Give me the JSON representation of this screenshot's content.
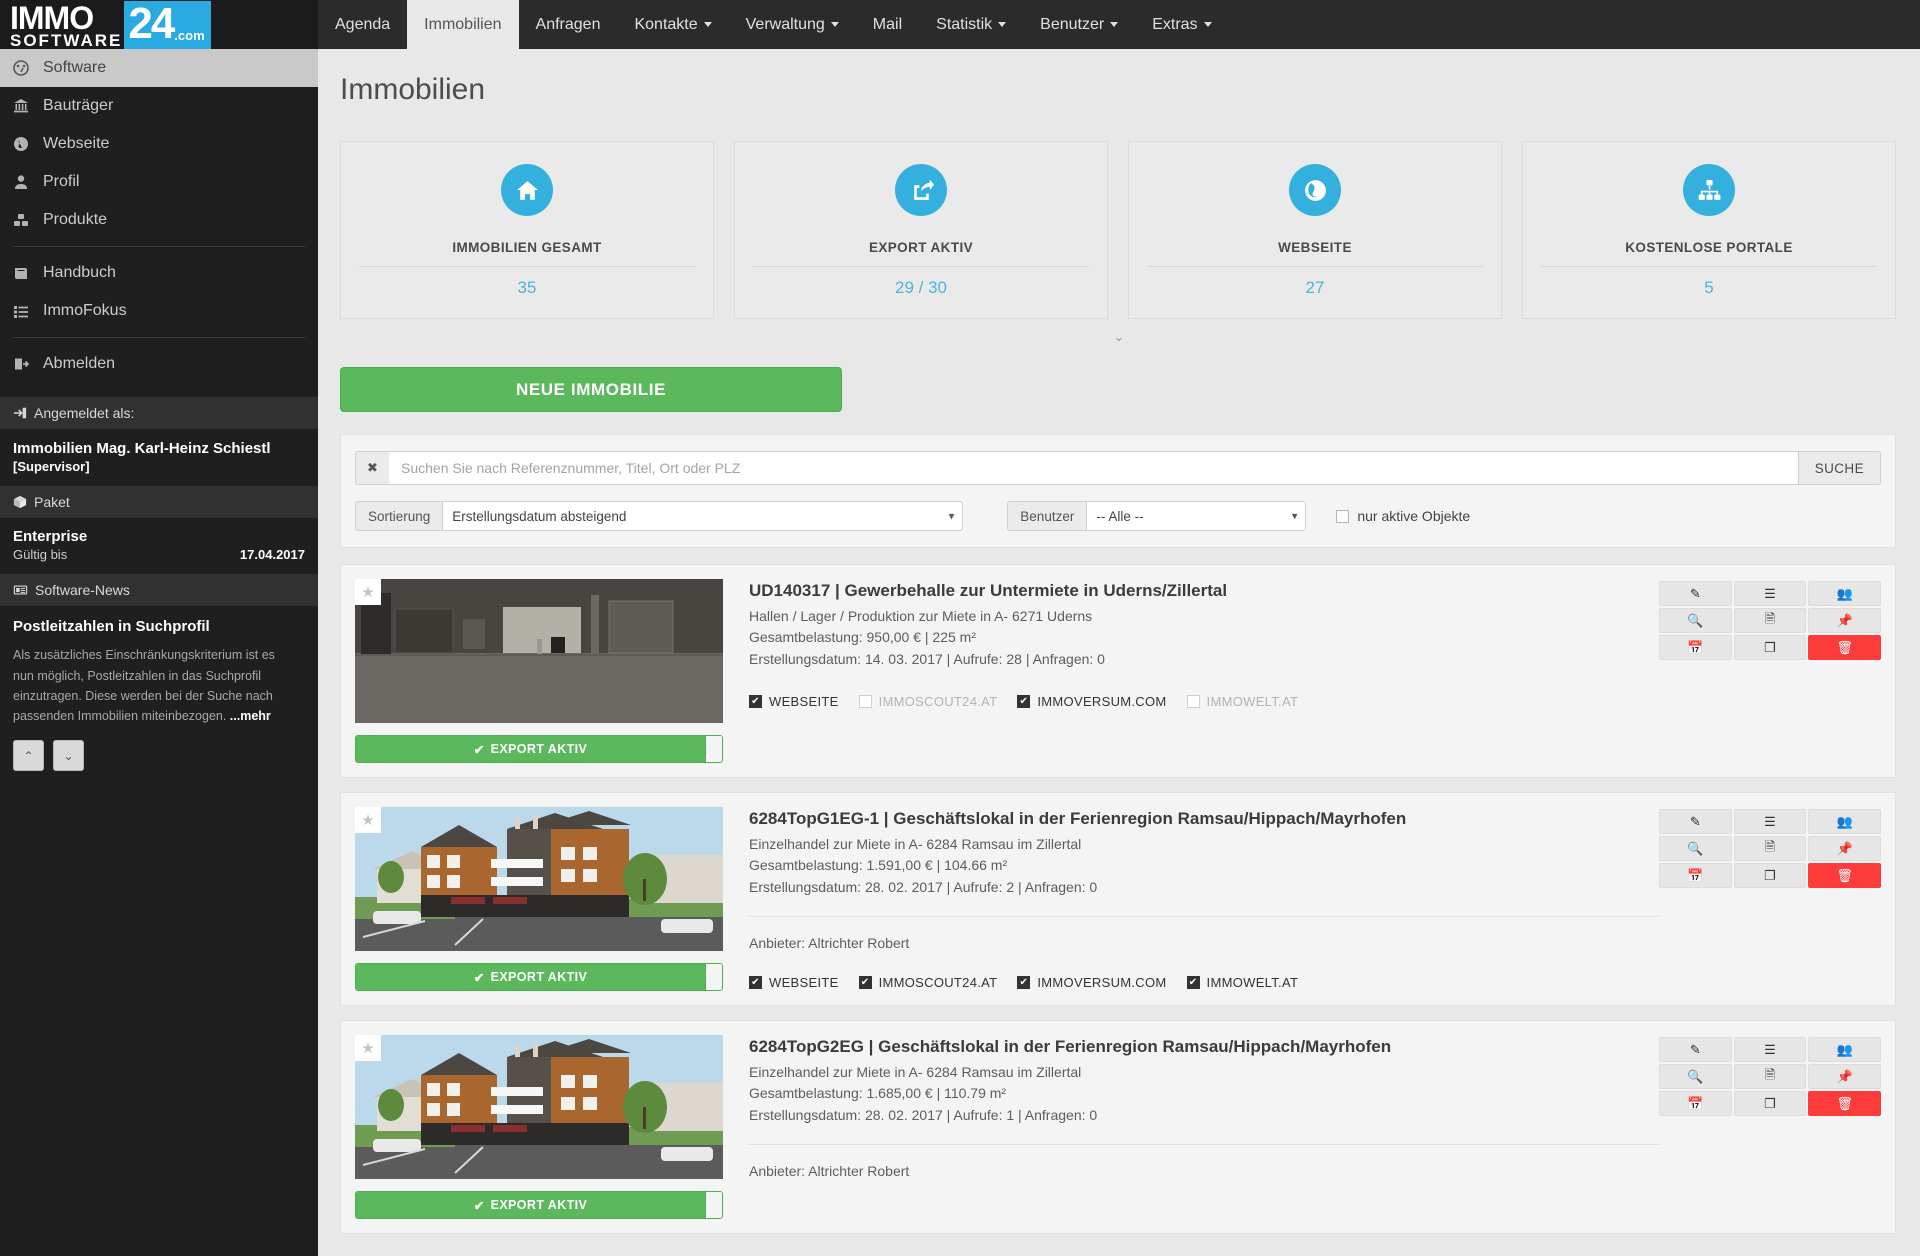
{
  "brand": {
    "immo": "IMMO",
    "software": "SOFTWARE",
    "num": "24",
    "com": ".com"
  },
  "topnav": {
    "items": [
      {
        "label": "Agenda",
        "caret": false,
        "active": false
      },
      {
        "label": "Immobilien",
        "caret": false,
        "active": true
      },
      {
        "label": "Anfragen",
        "caret": false,
        "active": false
      },
      {
        "label": "Kontakte",
        "caret": true,
        "active": false
      },
      {
        "label": "Verwaltung",
        "caret": true,
        "active": false
      },
      {
        "label": "Mail",
        "caret": false,
        "active": false
      },
      {
        "label": "Statistik",
        "caret": true,
        "active": false
      },
      {
        "label": "Benutzer",
        "caret": true,
        "active": false
      },
      {
        "label": "Extras",
        "caret": true,
        "active": false
      }
    ]
  },
  "sidebar": {
    "items": [
      {
        "label": "Software",
        "icon": "dashboard-icon",
        "glyph": "◉",
        "active": true
      },
      {
        "label": "Bauträger",
        "icon": "bank-icon",
        "glyph": "🏛",
        "active": false
      },
      {
        "label": "Webseite",
        "icon": "globe-icon",
        "glyph": "🌐",
        "active": false
      },
      {
        "label": "Profil",
        "icon": "user-icon",
        "glyph": "👤",
        "active": false
      },
      {
        "label": "Produkte",
        "icon": "cubes-icon",
        "glyph": "❏",
        "active": false
      },
      {
        "label": "Handbuch",
        "icon": "book-icon",
        "glyph": "📕",
        "active": false
      },
      {
        "label": "ImmoFokus",
        "icon": "list-icon",
        "glyph": "☰",
        "active": false
      },
      {
        "label": "Abmelden",
        "icon": "logout-icon",
        "glyph": "⇥",
        "active": false
      }
    ],
    "account": {
      "header": "Angemeldet als:",
      "name": "Immobilien Mag. Karl-Heinz Schiestl",
      "role": "[Supervisor]"
    },
    "paket": {
      "header": "Paket",
      "name": "Enterprise",
      "valid_label": "Gültig bis",
      "valid_until": "17.04.2017"
    },
    "news": {
      "header": "Software-News",
      "title": "Postleitzahlen in Suchprofil",
      "text": "Als zusätzliches Einschränkungskriterium ist es nun möglich, Postleitzahlen in das Suchprofil einzutragen. Diese werden bei der Suche nach passenden Immobilien miteinbezogen. ",
      "more": "...mehr",
      "prev": "⌃",
      "next": "⌄"
    }
  },
  "page": {
    "title": "Immobilien"
  },
  "cards": [
    {
      "label": "IMMOBILIEN GESAMT",
      "value": "35",
      "icon": "home-icon"
    },
    {
      "label": "EXPORT AKTIV",
      "value": "29 / 30",
      "icon": "share-icon"
    },
    {
      "label": "WEBSEITE",
      "value": "27",
      "icon": "globe-icon"
    },
    {
      "label": "KOSTENLOSE PORTALE",
      "value": "5",
      "icon": "sitemap-icon"
    }
  ],
  "collapse_chevron": "⌄",
  "new_button": {
    "label": "NEUE IMMOBILIE"
  },
  "search": {
    "clear": "✖",
    "placeholder": "Suchen Sie nach Referenznummer, Titel, Ort oder PLZ",
    "value": "",
    "button": "SUCHE"
  },
  "filters": {
    "sort_label": "Sortierung",
    "sort_value": "Erstellungsdatum absteigend",
    "user_label": "Benutzer",
    "user_value": "-- Alle --",
    "active_only_label": "nur aktive Objekte",
    "active_only_checked": false
  },
  "export_label": "EXPORT AKTIV",
  "export_check": "✔",
  "actions": [
    {
      "name": "edit-button",
      "glyph": "✎"
    },
    {
      "name": "details-button",
      "glyph": "☰"
    },
    {
      "name": "contacts-button",
      "glyph": "👥"
    },
    {
      "name": "preview-button",
      "glyph": "🔍"
    },
    {
      "name": "pdf-button",
      "glyph": "🗎"
    },
    {
      "name": "pin-button",
      "glyph": "📌"
    },
    {
      "name": "calendar-button",
      "glyph": "📅"
    },
    {
      "name": "copy-button",
      "glyph": "❐"
    },
    {
      "name": "delete-button",
      "glyph": "🗑"
    }
  ],
  "listings": [
    {
      "title": "UD140317 | Gewerbehalle zur Untermiete in Uderns/Zillertal",
      "subtitle": "Hallen / Lager / Produktion zur Miete in A- 6271 Uderns",
      "cost": "Gesamtbelastung: 950,00 € | 225 m²",
      "meta": "Erstellungsdatum: 14. 03. 2017 | Aufrufe: 28 | Anfragen: 0",
      "anbieter": "",
      "image": "warehouse-interior",
      "portals": [
        {
          "label": "WEBSEITE",
          "checked": true
        },
        {
          "label": "IMMOSCOUT24.AT",
          "checked": false
        },
        {
          "label": "IMMOVERSUM.COM",
          "checked": true
        },
        {
          "label": "IMMOWELT.AT",
          "checked": false
        }
      ]
    },
    {
      "title": "6284TopG1EG-1 | Geschäftslokal in der Ferienregion Ramsau/Hippach/Mayrhofen",
      "subtitle": "Einzelhandel zur Miete in A- 6284 Ramsau im Zillertal",
      "cost": "Gesamtbelastung: 1.591,00 € | 104.66 m²",
      "meta": "Erstellungsdatum: 28. 02. 2017 | Aufrufe: 2 | Anfragen: 0",
      "anbieter": "Anbieter:  Altrichter Robert",
      "image": "building-render",
      "portals": [
        {
          "label": "WEBSEITE",
          "checked": true
        },
        {
          "label": "IMMOSCOUT24.AT",
          "checked": true
        },
        {
          "label": "IMMOVERSUM.COM",
          "checked": true
        },
        {
          "label": "IMMOWELT.AT",
          "checked": true
        }
      ]
    },
    {
      "title": "6284TopG2EG | Geschäftslokal in der Ferienregion Ramsau/Hippach/Mayrhofen",
      "subtitle": "Einzelhandel zur Miete in A- 6284 Ramsau im Zillertal",
      "cost": "Gesamtbelastung: 1.685,00 € | 110.79 m²",
      "meta": "Erstellungsdatum: 28. 02. 2017 | Aufrufe: 1 | Anfragen: 0",
      "anbieter": "Anbieter:  Altrichter Robert",
      "image": "building-render",
      "portals": []
    }
  ],
  "colors": {
    "accent": "#33b0dd",
    "green": "#5cb85c",
    "danger": "#fc3b3b",
    "dark": "#1f1f1f"
  }
}
